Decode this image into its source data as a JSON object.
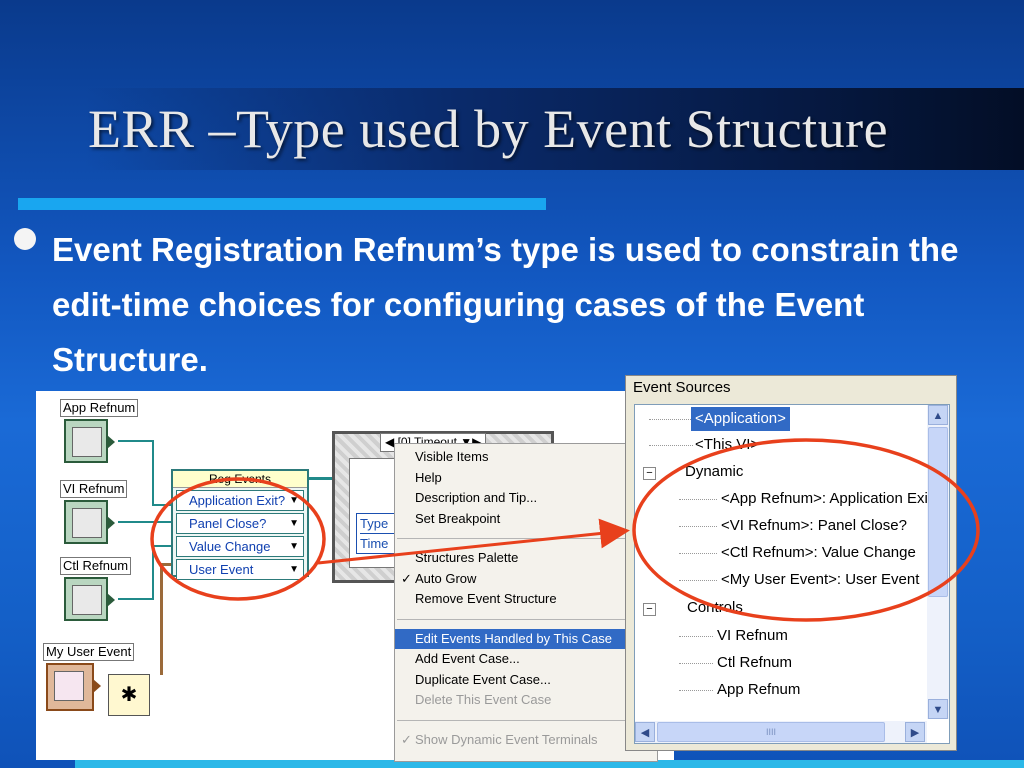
{
  "slide": {
    "title": "ERR –Type used by Event Structure",
    "bullet": "Event Registration Refnum’s type is used to constrain the edit-time choices for configuring cases of the Event Structure."
  },
  "diagram": {
    "labels": {
      "app_refnum": "App Refnum",
      "vi_refnum": "VI Refnum",
      "ctl_refnum": "Ctl Refnum",
      "my_user_event": "My User Event"
    },
    "reg_events": {
      "header": "Reg Events",
      "rows": [
        "Application Exit?",
        "Panel Close?",
        "Value Change",
        "User Event"
      ]
    },
    "event_structure": {
      "selector": "[0] Timeout",
      "terminals": [
        "Type",
        "Time"
      ]
    }
  },
  "context_menu": {
    "group1": [
      "Visible Items",
      "Help",
      "Description and Tip...",
      "Set Breakpoint"
    ],
    "group2": [
      "Structures Palette",
      "Auto Grow",
      "Remove Event Structure"
    ],
    "group3": [
      "Edit Events Handled by This Case",
      "Add Event Case...",
      "Duplicate Event Case...",
      "Delete This Event Case"
    ],
    "group4": [
      "Show Dynamic Event Terminals"
    ]
  },
  "event_sources": {
    "title": "Event Sources",
    "application": "<Application>",
    "this_vi": "<This VI>",
    "dynamic": "Dynamic",
    "dynamic_items": [
      "<App Refnum>: Application Exit",
      "<VI Refnum>: Panel Close?",
      "<Ctl Refnum>: Value Change",
      "<My User Event>: User Event"
    ],
    "controls": "Controls",
    "control_items": [
      "VI Refnum",
      "Ctl Refnum",
      "App Refnum"
    ]
  },
  "colors": {
    "selection": "#316ac5",
    "annotation": "#e8401c",
    "accent": "#19a6f0"
  }
}
